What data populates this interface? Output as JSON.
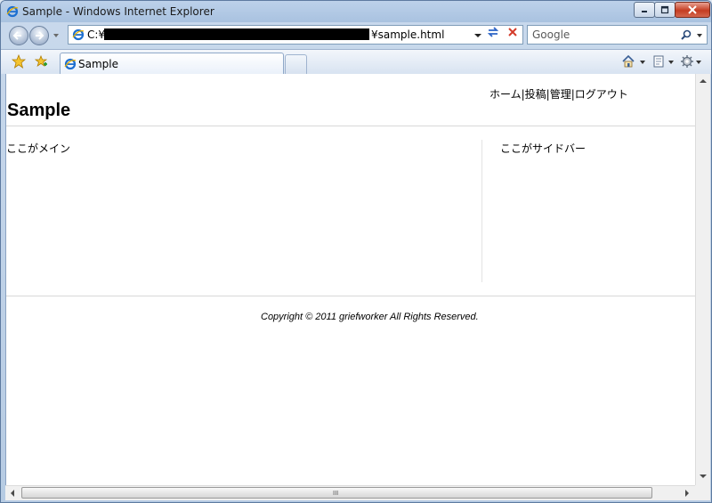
{
  "window": {
    "title": "Sample - Windows Internet Explorer"
  },
  "address_bar": {
    "url_prefix": "C:¥",
    "url_suffix": "¥sample.html"
  },
  "search": {
    "placeholder": "Google"
  },
  "tab": {
    "label": "Sample"
  },
  "page": {
    "header_nav": "ホーム|投稿|管理|ログアウト",
    "title": "Sample",
    "main_text": "ここがメイン",
    "sidebar_text": "ここがサイドバー",
    "footer_text": "Copyright © 2011 griefworker All Rights Reserved."
  },
  "scrollbar": {
    "grip": "III"
  },
  "colors": {
    "close_button": "#c43c22",
    "refresh_icon": "#2c64c6",
    "stop_icon": "#d33b2a"
  },
  "icons": [
    "ie-icon",
    "minimize-icon",
    "maximize-icon",
    "close-icon",
    "back-icon",
    "forward-icon",
    "refresh-icon",
    "stop-icon",
    "search-icon",
    "favorites-star-icon",
    "add-favorites-icon",
    "home-icon",
    "page-icon",
    "tools-gear-icon"
  ]
}
